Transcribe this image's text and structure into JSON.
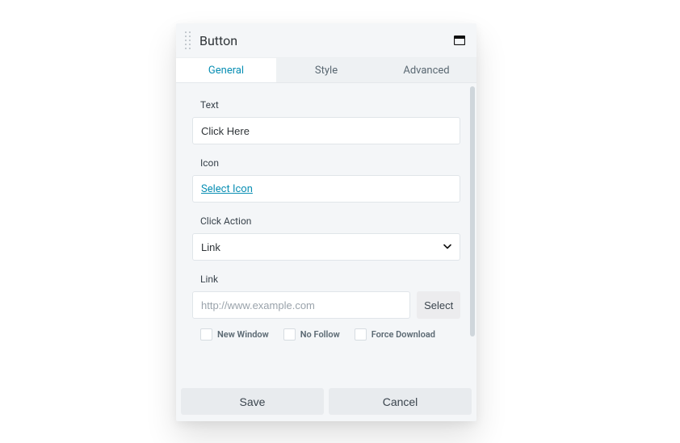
{
  "header": {
    "title": "Button"
  },
  "tabs": {
    "general": "General",
    "style": "Style",
    "advanced": "Advanced",
    "active": "general"
  },
  "fields": {
    "text": {
      "label": "Text",
      "value": "Click Here"
    },
    "icon": {
      "label": "Icon",
      "select_link": "Select Icon"
    },
    "click_action": {
      "label": "Click Action",
      "value": "Link"
    },
    "link": {
      "label": "Link",
      "placeholder": "http://www.example.com",
      "value": "",
      "select_button": "Select",
      "options": {
        "new_window": {
          "label": "New Window",
          "checked": false
        },
        "no_follow": {
          "label": "No Follow",
          "checked": false
        },
        "force_download": {
          "label": "Force Download",
          "checked": false
        }
      }
    }
  },
  "footer": {
    "save": "Save",
    "cancel": "Cancel"
  }
}
